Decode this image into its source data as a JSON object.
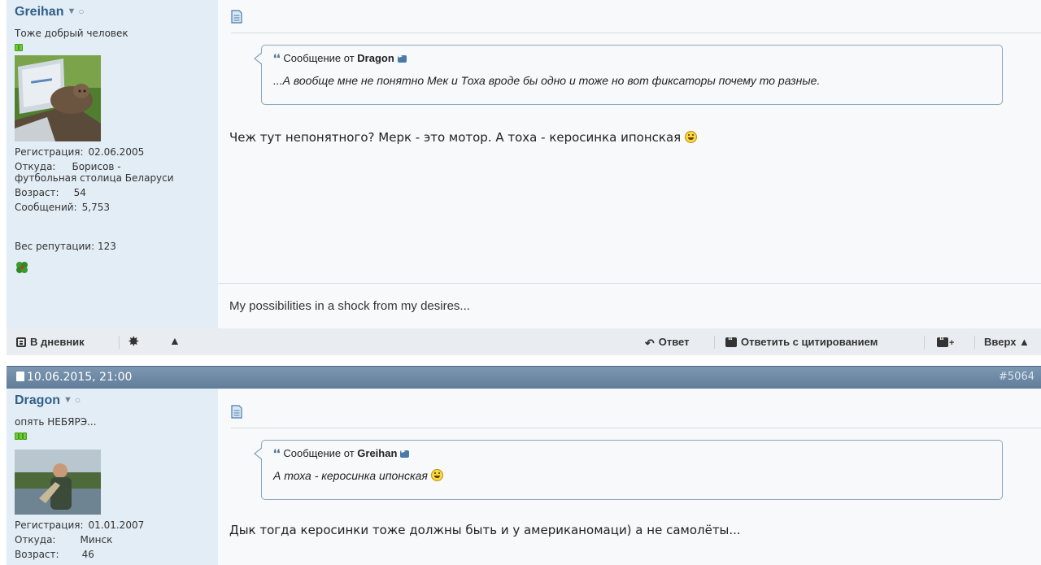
{
  "post1": {
    "username": "Greihan",
    "user_title": "Тоже добрый человек",
    "reputation_bars": 2,
    "stats": [
      {
        "label": "Регистрация:",
        "value": "02.06.2005"
      },
      {
        "label": "Откуда:",
        "value": "Борисов - футбольная столица Беларуси"
      },
      {
        "label": "Возраст:",
        "value": "54"
      },
      {
        "label": "Сообщений:",
        "value": "5,753"
      }
    ],
    "reputation_label": "Вес репутации:",
    "reputation_value": "123",
    "quote": {
      "prefix": "Сообщение от",
      "author": "Dragon",
      "text": "...А вообще мне не понятно Мек и Тоха вроде бы одно и тоже но вот фиксаторы почему то разные."
    },
    "message": "Чеж тут непонятного? Мерк - это мотор. А тоха - керосинка ипонская",
    "signature": "My possibilities in a shock from my desires..."
  },
  "actions": {
    "diary": "В дневник",
    "reply": "Ответ",
    "reply_quote": "Ответить с цитированием",
    "top": "Вверх ▲"
  },
  "post2": {
    "date": "10.06.2015, 21:00",
    "post_number": "#5064",
    "username": "Dragon",
    "user_title": "опять НЕБЯРЭ...",
    "reputation_bars": 3,
    "stats": [
      {
        "label": "Регистрация:",
        "value": "01.01.2007"
      },
      {
        "label": "Откуда:",
        "value": "Минск"
      },
      {
        "label": "Возраст:",
        "value": "46"
      }
    ],
    "quote": {
      "prefix": "Сообщение от",
      "author": "Greihan",
      "text": "А тоха - керосинка ипонская"
    },
    "message": "Дык тогда керосинки тоже должны быть и у американомаци) а не самолёты..."
  },
  "colors": {
    "userinfo_bg": "#e3edf5",
    "header_bg": "#6f8aa5",
    "username": "#2f5f8a",
    "quote_border": "#8aa6c0"
  }
}
